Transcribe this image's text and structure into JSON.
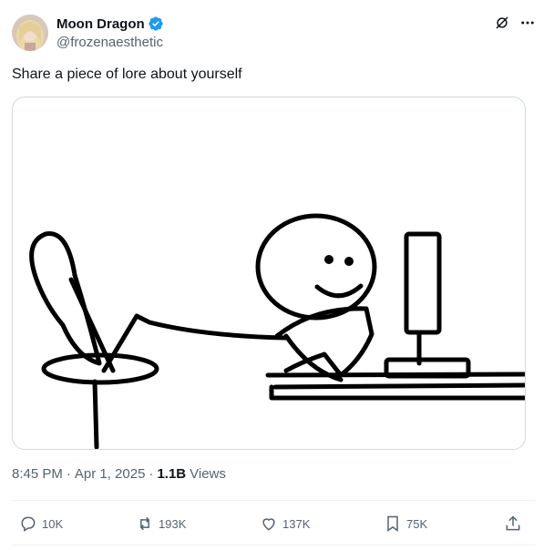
{
  "author": {
    "display_name": "Moon Dragon",
    "handle": "@frozenaesthetic",
    "verified": true
  },
  "tweet": {
    "text": "Share a piece of lore about yourself",
    "time": "8:45 PM",
    "date": "Apr 1, 2025",
    "views_count": "1.1B",
    "views_label": "Views"
  },
  "actions": {
    "replies": "10K",
    "reposts": "193K",
    "likes": "137K",
    "bookmarks": "75K"
  },
  "icons": [
    "grok-icon",
    "more-icon",
    "verified-badge-icon",
    "reply-icon",
    "repost-icon",
    "like-icon",
    "bookmark-icon",
    "share-icon"
  ],
  "colors": {
    "verified": "#1d9bf0",
    "secondary_text": "#536471",
    "border": "#cfd9de"
  }
}
